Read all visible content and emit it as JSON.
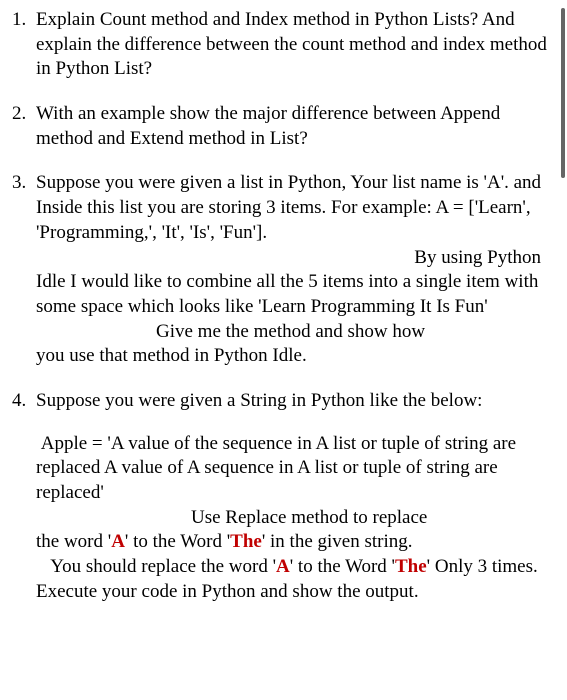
{
  "items": [
    {
      "p1": "Explain Count method and Index method in Python Lists? And explain the difference between the count method and index method in Python List?"
    },
    {
      "p1": "With an example show the major difference between Append method and Extend method in List?"
    },
    {
      "p1": "Suppose you were given a list in Python, Your list name is 'A'. and Inside this list you are storing 3 items. For example: A = ['Learn', 'Programming,', 'It', 'Is', 'Fun'].",
      "p2a": "By using Python",
      "p2": "Idle I would like to combine all the 5 items into a single item with some space which looks like 'Learn Programming It Is Fun'",
      "p3a": "Give me the method and show how",
      "p3": "you use that method in Python Idle."
    },
    {
      "p1": "Suppose you were given a String in Python like the below:",
      "p2": " Apple = 'A value of the sequence in A list or tuple of string are replaced A value of A sequence in A list or tuple of string are replaced'",
      "p3a": "Use Replace method to replace",
      "p3b_pre": "the word '",
      "p3b_a": "A",
      "p3b_mid": "' to the Word '",
      "p3b_the": "The",
      "p3b_post": "' in the given string.",
      "p4_pre": "   You should replace the word '",
      "p4_a": "A",
      "p4_mid": "' to the Word '",
      "p4_the": "The",
      "p4_post": "' Only 3 times.",
      "p5": "Execute your code in Python and show the output."
    }
  ]
}
